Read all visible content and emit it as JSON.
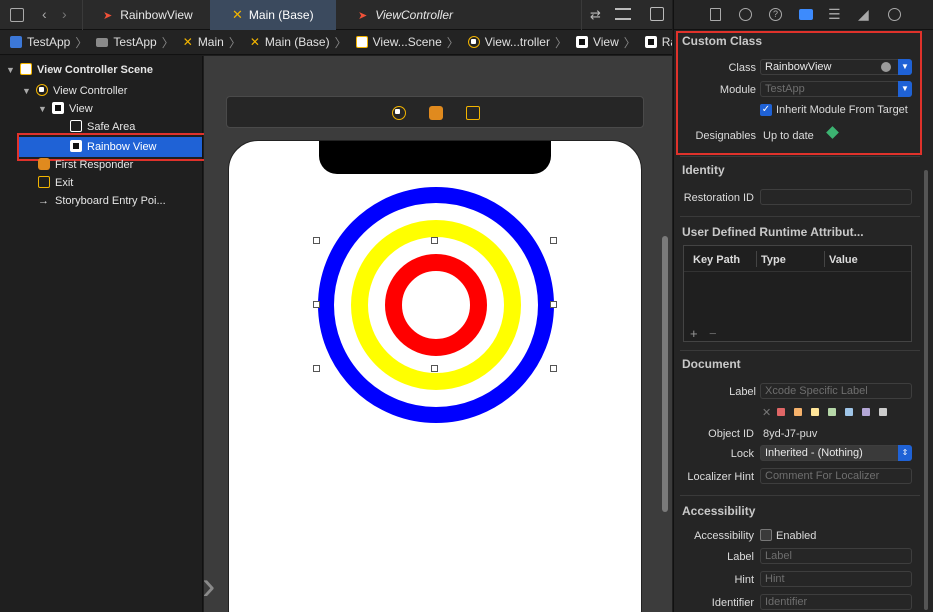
{
  "tabs": [
    {
      "label": "RainbowView",
      "active": false
    },
    {
      "label": "Main (Base)",
      "active": true
    },
    {
      "label": "ViewController",
      "active": false
    }
  ],
  "breadcrumbs": [
    "TestApp",
    "TestApp",
    "Main",
    "Main (Base)",
    "View...Scene",
    "View...troller",
    "View",
    "Rainbow View"
  ],
  "navigator": {
    "scene_title": "View Controller Scene",
    "items": [
      {
        "label": "View Controller"
      },
      {
        "label": "View"
      },
      {
        "label": "Safe Area"
      },
      {
        "label": "Rainbow View",
        "selected": true
      },
      {
        "label": "First Responder"
      },
      {
        "label": "Exit"
      },
      {
        "label": "Storyboard Entry Poi..."
      }
    ]
  },
  "inspector": {
    "custom_class": {
      "title": "Custom Class",
      "class_label": "Class",
      "class_value": "RainbowView",
      "module_label": "Module",
      "module_placeholder": "TestApp",
      "inherit_label": "Inherit Module From Target",
      "inherit_checked": true,
      "designables_label": "Designables",
      "designables_value": "Up to date"
    },
    "identity": {
      "title": "Identity",
      "restoration_label": "Restoration ID"
    },
    "udra": {
      "title": "User Defined Runtime Attribut...",
      "columns": [
        "Key Path",
        "Type",
        "Value"
      ],
      "add": "+",
      "remove": "−"
    },
    "document": {
      "title": "Document",
      "label_label": "Label",
      "label_placeholder": "Xcode Specific Label",
      "swatch_colors": [
        "#e06666",
        "#f6b26b",
        "#ffe599",
        "#b6d7a8",
        "#9fc5e8",
        "#b4a7d6",
        "#cccccc"
      ],
      "object_id_label": "Object ID",
      "object_id_value": "8yd-J7-puv",
      "lock_label": "Lock",
      "lock_value": "Inherited - (Nothing)",
      "localizer_label": "Localizer Hint",
      "localizer_placeholder": "Comment For Localizer"
    },
    "accessibility": {
      "title": "Accessibility",
      "accessibility_label": "Accessibility",
      "enabled_label": "Enabled",
      "label_label": "Label",
      "label_placeholder": "Label",
      "hint_label": "Hint",
      "hint_placeholder": "Hint",
      "identifier_label": "Identifier",
      "identifier_placeholder": "Identifier"
    }
  },
  "colors": {
    "accent": "#1f62d6",
    "highlight_box": "#e0322b",
    "ring_outer": "#0000ff",
    "ring_middle": "#ffff00",
    "ring_inner": "#ff0000"
  }
}
